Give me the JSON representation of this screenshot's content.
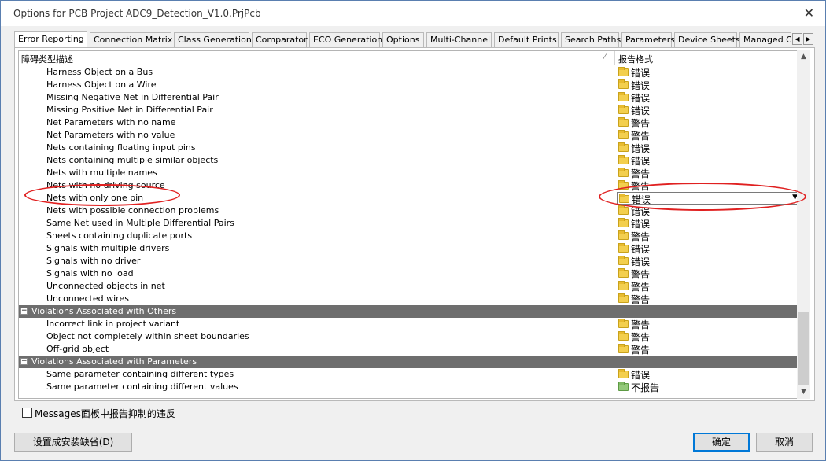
{
  "window": {
    "title": "Options for PCB Project ADC9_Detection_V1.0.PrjPcb"
  },
  "icons": {
    "close": "close-icon",
    "folder": "folder-icon",
    "collapse": "minus-box-icon",
    "dropdown": "chevron-down-icon"
  },
  "colors": {
    "error_folder": "#f3cf4e",
    "ignore_folder": "#93c97a",
    "group_header": "#6e6e6e",
    "annotation": "#e02020"
  },
  "tabs": [
    {
      "label": "Error Reporting",
      "active": true
    },
    {
      "label": "Connection Matrix"
    },
    {
      "label": "Class Generation"
    },
    {
      "label": "Comparator"
    },
    {
      "label": "ECO Generation"
    },
    {
      "label": "Options"
    },
    {
      "label": "Multi-Channel"
    },
    {
      "label": "Default Prints"
    },
    {
      "label": "Search Paths"
    },
    {
      "label": "Parameters"
    },
    {
      "label": "Device Sheets"
    },
    {
      "label": "Managed O"
    }
  ],
  "grid": {
    "col_description": "障碍类型描述",
    "col_report": "报告格式",
    "rows": [
      {
        "label": "Harness Object on a Bus",
        "value": "错误"
      },
      {
        "label": "Harness Object on a Wire",
        "value": "错误"
      },
      {
        "label": "Missing Negative Net in Differential Pair",
        "value": "错误"
      },
      {
        "label": "Missing Positive Net in Differential Pair",
        "value": "错误"
      },
      {
        "label": "Net Parameters with no name",
        "value": "警告"
      },
      {
        "label": "Net Parameters with no value",
        "value": "警告"
      },
      {
        "label": "Nets containing floating input pins",
        "value": "错误"
      },
      {
        "label": "Nets containing multiple similar objects",
        "value": "错误"
      },
      {
        "label": "Nets with multiple names",
        "value": "警告"
      },
      {
        "label": "Nets with no driving source",
        "value": "警告"
      },
      {
        "label": "Nets with only one pin",
        "value": "错误",
        "editing": true
      },
      {
        "label": "Nets with possible connection problems",
        "value": "错误"
      },
      {
        "label": "Same Net used in Multiple Differential Pairs",
        "value": "错误"
      },
      {
        "label": "Sheets containing duplicate ports",
        "value": "警告"
      },
      {
        "label": "Signals with multiple drivers",
        "value": "错误"
      },
      {
        "label": "Signals with no driver",
        "value": "错误"
      },
      {
        "label": "Signals with no load",
        "value": "警告"
      },
      {
        "label": "Unconnected objects in net",
        "value": "警告"
      },
      {
        "label": "Unconnected wires",
        "value": "警告"
      }
    ],
    "group_others": {
      "label": "Violations Associated with Others",
      "rows": [
        {
          "label": "Incorrect link in project variant",
          "value": "警告"
        },
        {
          "label": "Object not completely within sheet boundaries",
          "value": "警告"
        },
        {
          "label": "Off-grid object",
          "value": "警告"
        }
      ]
    },
    "group_parameters": {
      "label": "Violations Associated with Parameters",
      "rows": [
        {
          "label": "Same parameter containing different types",
          "value": "错误"
        },
        {
          "label": "Same parameter containing different values",
          "value": "不报告"
        }
      ]
    }
  },
  "footer": {
    "messages_checkbox": "Messages面板中报告抑制的违反",
    "reset_button": "设置成安装缺省(D)",
    "ok_button": "确定",
    "cancel_button": "取消"
  }
}
